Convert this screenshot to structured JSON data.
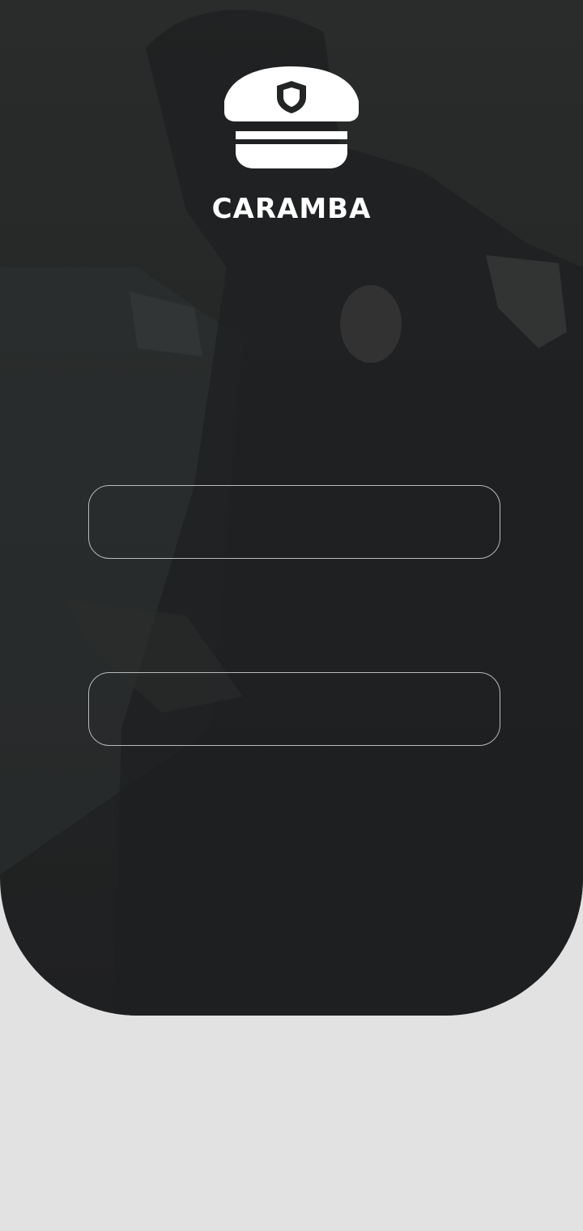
{
  "app": {
    "brand_name": "CARAMBA",
    "logo_icon": "police-cap-shield-icon"
  },
  "form": {
    "login_field": {
      "value": "",
      "placeholder": ""
    },
    "password_field": {
      "value": "",
      "placeholder": ""
    }
  },
  "colors": {
    "panel_dark": "#232525",
    "page_background": "#e2e2e2",
    "field_border": "#b9bbbb",
    "text_primary": "#ffffff"
  }
}
